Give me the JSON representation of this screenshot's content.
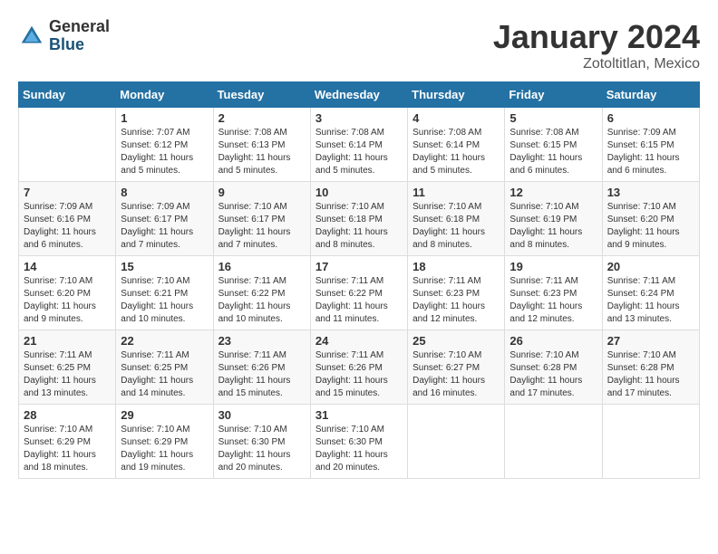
{
  "logo": {
    "general": "General",
    "blue": "Blue"
  },
  "title": "January 2024",
  "location": "Zotoltitlan, Mexico",
  "weekdays": [
    "Sunday",
    "Monday",
    "Tuesday",
    "Wednesday",
    "Thursday",
    "Friday",
    "Saturday"
  ],
  "weeks": [
    [
      {
        "day": "",
        "info": ""
      },
      {
        "day": "1",
        "info": "Sunrise: 7:07 AM\nSunset: 6:12 PM\nDaylight: 11 hours\nand 5 minutes."
      },
      {
        "day": "2",
        "info": "Sunrise: 7:08 AM\nSunset: 6:13 PM\nDaylight: 11 hours\nand 5 minutes."
      },
      {
        "day": "3",
        "info": "Sunrise: 7:08 AM\nSunset: 6:14 PM\nDaylight: 11 hours\nand 5 minutes."
      },
      {
        "day": "4",
        "info": "Sunrise: 7:08 AM\nSunset: 6:14 PM\nDaylight: 11 hours\nand 5 minutes."
      },
      {
        "day": "5",
        "info": "Sunrise: 7:08 AM\nSunset: 6:15 PM\nDaylight: 11 hours\nand 6 minutes."
      },
      {
        "day": "6",
        "info": "Sunrise: 7:09 AM\nSunset: 6:15 PM\nDaylight: 11 hours\nand 6 minutes."
      }
    ],
    [
      {
        "day": "7",
        "info": "Sunrise: 7:09 AM\nSunset: 6:16 PM\nDaylight: 11 hours\nand 6 minutes."
      },
      {
        "day": "8",
        "info": "Sunrise: 7:09 AM\nSunset: 6:17 PM\nDaylight: 11 hours\nand 7 minutes."
      },
      {
        "day": "9",
        "info": "Sunrise: 7:10 AM\nSunset: 6:17 PM\nDaylight: 11 hours\nand 7 minutes."
      },
      {
        "day": "10",
        "info": "Sunrise: 7:10 AM\nSunset: 6:18 PM\nDaylight: 11 hours\nand 8 minutes."
      },
      {
        "day": "11",
        "info": "Sunrise: 7:10 AM\nSunset: 6:18 PM\nDaylight: 11 hours\nand 8 minutes."
      },
      {
        "day": "12",
        "info": "Sunrise: 7:10 AM\nSunset: 6:19 PM\nDaylight: 11 hours\nand 8 minutes."
      },
      {
        "day": "13",
        "info": "Sunrise: 7:10 AM\nSunset: 6:20 PM\nDaylight: 11 hours\nand 9 minutes."
      }
    ],
    [
      {
        "day": "14",
        "info": "Sunrise: 7:10 AM\nSunset: 6:20 PM\nDaylight: 11 hours\nand 9 minutes."
      },
      {
        "day": "15",
        "info": "Sunrise: 7:10 AM\nSunset: 6:21 PM\nDaylight: 11 hours\nand 10 minutes."
      },
      {
        "day": "16",
        "info": "Sunrise: 7:11 AM\nSunset: 6:22 PM\nDaylight: 11 hours\nand 10 minutes."
      },
      {
        "day": "17",
        "info": "Sunrise: 7:11 AM\nSunset: 6:22 PM\nDaylight: 11 hours\nand 11 minutes."
      },
      {
        "day": "18",
        "info": "Sunrise: 7:11 AM\nSunset: 6:23 PM\nDaylight: 11 hours\nand 12 minutes."
      },
      {
        "day": "19",
        "info": "Sunrise: 7:11 AM\nSunset: 6:23 PM\nDaylight: 11 hours\nand 12 minutes."
      },
      {
        "day": "20",
        "info": "Sunrise: 7:11 AM\nSunset: 6:24 PM\nDaylight: 11 hours\nand 13 minutes."
      }
    ],
    [
      {
        "day": "21",
        "info": "Sunrise: 7:11 AM\nSunset: 6:25 PM\nDaylight: 11 hours\nand 13 minutes."
      },
      {
        "day": "22",
        "info": "Sunrise: 7:11 AM\nSunset: 6:25 PM\nDaylight: 11 hours\nand 14 minutes."
      },
      {
        "day": "23",
        "info": "Sunrise: 7:11 AM\nSunset: 6:26 PM\nDaylight: 11 hours\nand 15 minutes."
      },
      {
        "day": "24",
        "info": "Sunrise: 7:11 AM\nSunset: 6:26 PM\nDaylight: 11 hours\nand 15 minutes."
      },
      {
        "day": "25",
        "info": "Sunrise: 7:10 AM\nSunset: 6:27 PM\nDaylight: 11 hours\nand 16 minutes."
      },
      {
        "day": "26",
        "info": "Sunrise: 7:10 AM\nSunset: 6:28 PM\nDaylight: 11 hours\nand 17 minutes."
      },
      {
        "day": "27",
        "info": "Sunrise: 7:10 AM\nSunset: 6:28 PM\nDaylight: 11 hours\nand 17 minutes."
      }
    ],
    [
      {
        "day": "28",
        "info": "Sunrise: 7:10 AM\nSunset: 6:29 PM\nDaylight: 11 hours\nand 18 minutes."
      },
      {
        "day": "29",
        "info": "Sunrise: 7:10 AM\nSunset: 6:29 PM\nDaylight: 11 hours\nand 19 minutes."
      },
      {
        "day": "30",
        "info": "Sunrise: 7:10 AM\nSunset: 6:30 PM\nDaylight: 11 hours\nand 20 minutes."
      },
      {
        "day": "31",
        "info": "Sunrise: 7:10 AM\nSunset: 6:30 PM\nDaylight: 11 hours\nand 20 minutes."
      },
      {
        "day": "",
        "info": ""
      },
      {
        "day": "",
        "info": ""
      },
      {
        "day": "",
        "info": ""
      }
    ]
  ]
}
